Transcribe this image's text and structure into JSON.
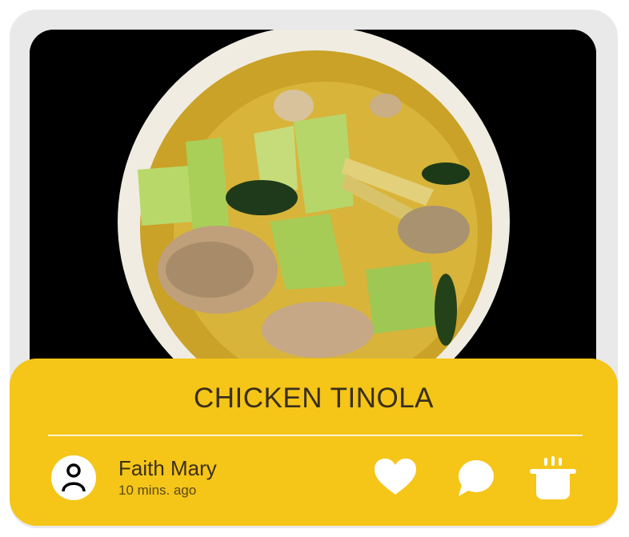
{
  "recipe": {
    "title": "CHICKEN TINOLA",
    "image_alt": "Bowl of chicken tinola soup with chayote and leafy greens"
  },
  "author": {
    "name": "Faith Mary",
    "posted": "10 mins. ago",
    "avatar_icon": "user-icon"
  },
  "actions": {
    "like_icon": "heart-icon",
    "comment_icon": "speech-bubble-icon",
    "cook_icon": "cooking-pot-icon"
  },
  "colors": {
    "panel": "#f5c518",
    "frame": "#e9e9e9",
    "text": "#3a2f1a"
  }
}
